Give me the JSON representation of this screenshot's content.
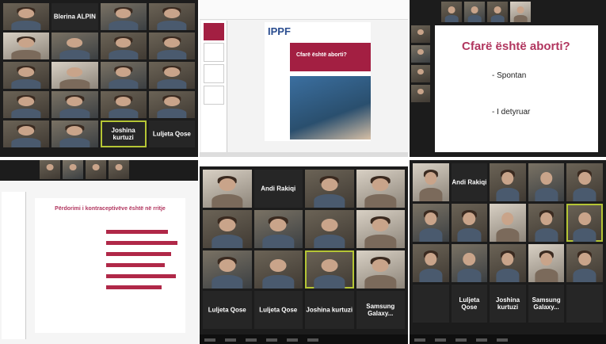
{
  "panel1": {
    "names": [
      "Blerina ALPIN",
      "Joshina kurtuzi",
      "Luljeta Qose"
    ]
  },
  "panel2": {
    "logo": "IPPF",
    "slide_title": "Cfarë është aborti?"
  },
  "panel3": {
    "slide_title": "Cfarë është aborti?",
    "bullets": [
      "Spontan",
      "I detyruar"
    ]
  },
  "panel4": {
    "chart_title": "Përdorimi i kontraceptivëve është në rritje"
  },
  "panel5": {
    "names": [
      "Andi Rakiqi",
      "Luljeta Qose",
      "Luljeta Qose",
      "Joshina kurtuzi",
      "Samsung Galaxy..."
    ]
  },
  "panel6": {
    "names": [
      "Andi Rakiqi",
      "Luljeta Qose",
      "Joshina kurtuzi",
      "Samsung Galaxy..."
    ]
  },
  "colors": {
    "accent": "#b5c535",
    "brand": "#a31f42"
  }
}
